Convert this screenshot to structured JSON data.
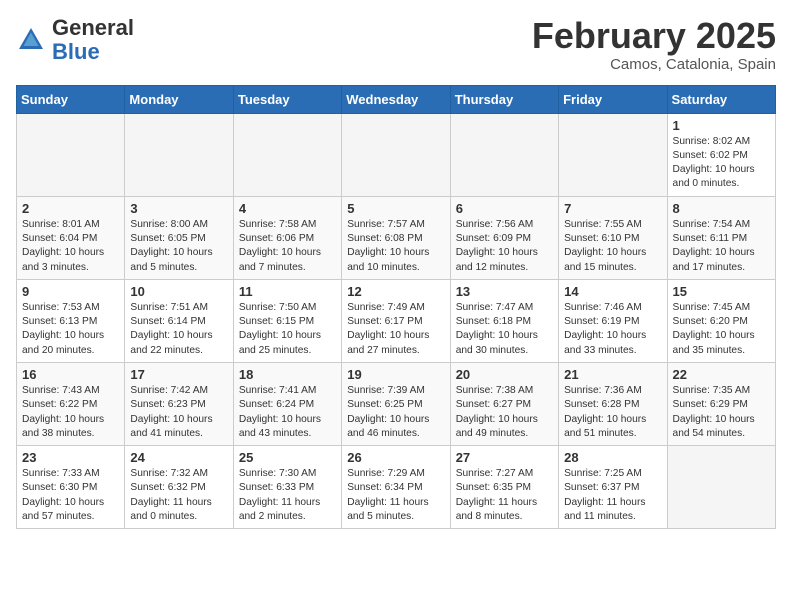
{
  "header": {
    "logo": {
      "general": "General",
      "blue": "Blue"
    },
    "month": "February 2025",
    "location": "Camos, Catalonia, Spain"
  },
  "days_of_week": [
    "Sunday",
    "Monday",
    "Tuesday",
    "Wednesday",
    "Thursday",
    "Friday",
    "Saturday"
  ],
  "weeks": [
    [
      {
        "day": "",
        "empty": true
      },
      {
        "day": "",
        "empty": true
      },
      {
        "day": "",
        "empty": true
      },
      {
        "day": "",
        "empty": true
      },
      {
        "day": "",
        "empty": true
      },
      {
        "day": "",
        "empty": true
      },
      {
        "day": "1",
        "sunrise": "Sunrise: 8:02 AM",
        "sunset": "Sunset: 6:02 PM",
        "daylight": "Daylight: 10 hours and 0 minutes."
      }
    ],
    [
      {
        "day": "2",
        "sunrise": "Sunrise: 8:01 AM",
        "sunset": "Sunset: 6:04 PM",
        "daylight": "Daylight: 10 hours and 3 minutes."
      },
      {
        "day": "3",
        "sunrise": "Sunrise: 8:00 AM",
        "sunset": "Sunset: 6:05 PM",
        "daylight": "Daylight: 10 hours and 5 minutes."
      },
      {
        "day": "4",
        "sunrise": "Sunrise: 7:58 AM",
        "sunset": "Sunset: 6:06 PM",
        "daylight": "Daylight: 10 hours and 7 minutes."
      },
      {
        "day": "5",
        "sunrise": "Sunrise: 7:57 AM",
        "sunset": "Sunset: 6:08 PM",
        "daylight": "Daylight: 10 hours and 10 minutes."
      },
      {
        "day": "6",
        "sunrise": "Sunrise: 7:56 AM",
        "sunset": "Sunset: 6:09 PM",
        "daylight": "Daylight: 10 hours and 12 minutes."
      },
      {
        "day": "7",
        "sunrise": "Sunrise: 7:55 AM",
        "sunset": "Sunset: 6:10 PM",
        "daylight": "Daylight: 10 hours and 15 minutes."
      },
      {
        "day": "8",
        "sunrise": "Sunrise: 7:54 AM",
        "sunset": "Sunset: 6:11 PM",
        "daylight": "Daylight: 10 hours and 17 minutes."
      }
    ],
    [
      {
        "day": "9",
        "sunrise": "Sunrise: 7:53 AM",
        "sunset": "Sunset: 6:13 PM",
        "daylight": "Daylight: 10 hours and 20 minutes."
      },
      {
        "day": "10",
        "sunrise": "Sunrise: 7:51 AM",
        "sunset": "Sunset: 6:14 PM",
        "daylight": "Daylight: 10 hours and 22 minutes."
      },
      {
        "day": "11",
        "sunrise": "Sunrise: 7:50 AM",
        "sunset": "Sunset: 6:15 PM",
        "daylight": "Daylight: 10 hours and 25 minutes."
      },
      {
        "day": "12",
        "sunrise": "Sunrise: 7:49 AM",
        "sunset": "Sunset: 6:17 PM",
        "daylight": "Daylight: 10 hours and 27 minutes."
      },
      {
        "day": "13",
        "sunrise": "Sunrise: 7:47 AM",
        "sunset": "Sunset: 6:18 PM",
        "daylight": "Daylight: 10 hours and 30 minutes."
      },
      {
        "day": "14",
        "sunrise": "Sunrise: 7:46 AM",
        "sunset": "Sunset: 6:19 PM",
        "daylight": "Daylight: 10 hours and 33 minutes."
      },
      {
        "day": "15",
        "sunrise": "Sunrise: 7:45 AM",
        "sunset": "Sunset: 6:20 PM",
        "daylight": "Daylight: 10 hours and 35 minutes."
      }
    ],
    [
      {
        "day": "16",
        "sunrise": "Sunrise: 7:43 AM",
        "sunset": "Sunset: 6:22 PM",
        "daylight": "Daylight: 10 hours and 38 minutes."
      },
      {
        "day": "17",
        "sunrise": "Sunrise: 7:42 AM",
        "sunset": "Sunset: 6:23 PM",
        "daylight": "Daylight: 10 hours and 41 minutes."
      },
      {
        "day": "18",
        "sunrise": "Sunrise: 7:41 AM",
        "sunset": "Sunset: 6:24 PM",
        "daylight": "Daylight: 10 hours and 43 minutes."
      },
      {
        "day": "19",
        "sunrise": "Sunrise: 7:39 AM",
        "sunset": "Sunset: 6:25 PM",
        "daylight": "Daylight: 10 hours and 46 minutes."
      },
      {
        "day": "20",
        "sunrise": "Sunrise: 7:38 AM",
        "sunset": "Sunset: 6:27 PM",
        "daylight": "Daylight: 10 hours and 49 minutes."
      },
      {
        "day": "21",
        "sunrise": "Sunrise: 7:36 AM",
        "sunset": "Sunset: 6:28 PM",
        "daylight": "Daylight: 10 hours and 51 minutes."
      },
      {
        "day": "22",
        "sunrise": "Sunrise: 7:35 AM",
        "sunset": "Sunset: 6:29 PM",
        "daylight": "Daylight: 10 hours and 54 minutes."
      }
    ],
    [
      {
        "day": "23",
        "sunrise": "Sunrise: 7:33 AM",
        "sunset": "Sunset: 6:30 PM",
        "daylight": "Daylight: 10 hours and 57 minutes."
      },
      {
        "day": "24",
        "sunrise": "Sunrise: 7:32 AM",
        "sunset": "Sunset: 6:32 PM",
        "daylight": "Daylight: 11 hours and 0 minutes."
      },
      {
        "day": "25",
        "sunrise": "Sunrise: 7:30 AM",
        "sunset": "Sunset: 6:33 PM",
        "daylight": "Daylight: 11 hours and 2 minutes."
      },
      {
        "day": "26",
        "sunrise": "Sunrise: 7:29 AM",
        "sunset": "Sunset: 6:34 PM",
        "daylight": "Daylight: 11 hours and 5 minutes."
      },
      {
        "day": "27",
        "sunrise": "Sunrise: 7:27 AM",
        "sunset": "Sunset: 6:35 PM",
        "daylight": "Daylight: 11 hours and 8 minutes."
      },
      {
        "day": "28",
        "sunrise": "Sunrise: 7:25 AM",
        "sunset": "Sunset: 6:37 PM",
        "daylight": "Daylight: 11 hours and 11 minutes."
      },
      {
        "day": "",
        "empty": true
      }
    ]
  ]
}
